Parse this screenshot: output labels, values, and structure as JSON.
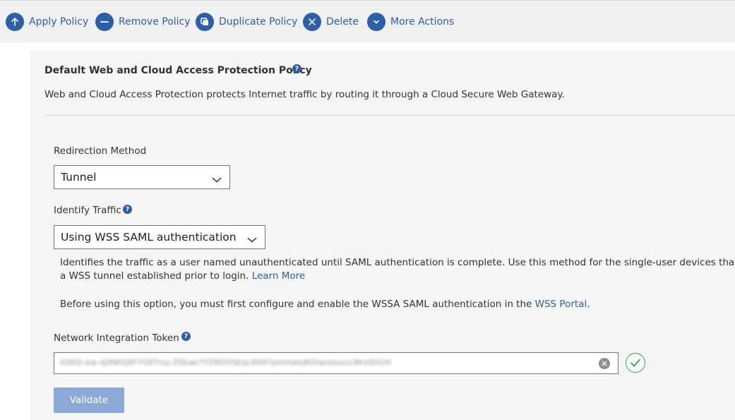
{
  "toolbar": {
    "buttons": [
      {
        "label": "Apply Policy",
        "icon": "arrow-up-icon"
      },
      {
        "label": "Remove Policy",
        "icon": "minus-icon"
      },
      {
        "label": "Duplicate Policy",
        "icon": "duplicate-icon"
      },
      {
        "label": "Delete",
        "icon": "close-icon"
      },
      {
        "label": "More Actions",
        "icon": "chevron-down-icon"
      }
    ],
    "accent": "#2d5fa6"
  },
  "policy": {
    "title": "Default Web and Cloud Access Protection Policy",
    "help": "?",
    "description": "Web and Cloud Access Protection protects Internet traffic by routing it through a Cloud Secure Web Gateway."
  },
  "redirection": {
    "label": "Redirection Method",
    "value": "Tunnel"
  },
  "identify": {
    "label": "Identify Traffic",
    "help": "?",
    "value": "Using WSS SAML authentication",
    "info_line1": "Identifies the traffic as a user named unauthenticated until SAML authentication is complete. Use this method for the single-user devices that are",
    "info_line2": "a WSS tunnel established prior to login.",
    "learn_more": "Learn More",
    "note_prefix": "Before using this option, you must first configure and enable the WSSA SAML authentication in the",
    "note_link": "WSS Portal",
    "note_suffix": "."
  },
  "token": {
    "label": "Network Integration Token",
    "help": "?",
    "value": "ASKD-aw-dj9W0j8FYS8Tnsj-Z0bak7YZ8DVHJlqL8A97pmHwkJKOiwsbaxsc8KsiDGiH",
    "validated_color": "#2aa545"
  },
  "actions": {
    "validate_label": "Validate"
  }
}
